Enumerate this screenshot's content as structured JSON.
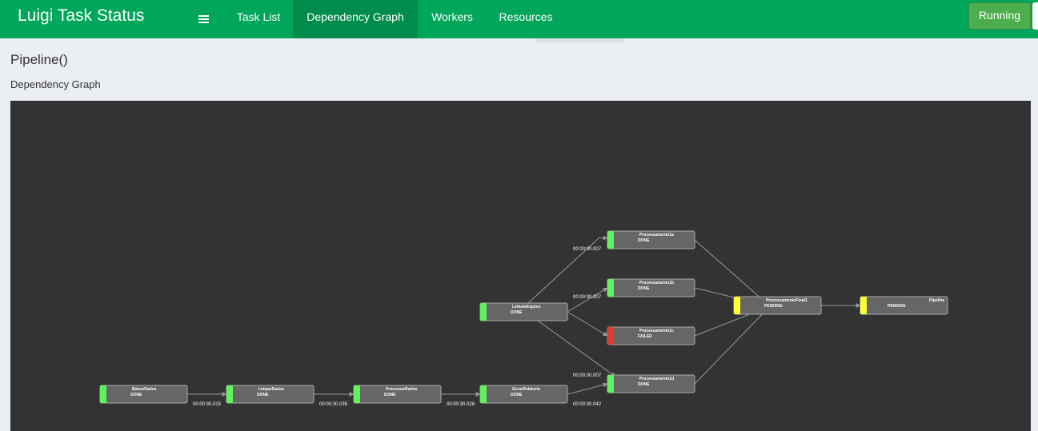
{
  "header": {
    "brand": "Luigi Task Status",
    "menu_icon": "hamburger-menu-icon",
    "tabs": [
      {
        "label": "Task List",
        "active": false
      },
      {
        "label": "Dependency Graph",
        "active": true
      },
      {
        "label": "Workers",
        "active": false
      },
      {
        "label": "Resources",
        "active": false
      }
    ],
    "status_button": "Running"
  },
  "page": {
    "title": "Pipeline()",
    "subtitle": "Dependency Graph"
  },
  "graph": {
    "status_colors": {
      "DONE": "#5ef25e",
      "FAILED": "#e23a2e",
      "PENDING": "#ffff3a"
    },
    "nodes": [
      {
        "id": "BaixarDados",
        "name": "BaixarDados",
        "status": "DONE"
      },
      {
        "id": "LimparDados",
        "name": "LimparDados",
        "status": "DONE"
      },
      {
        "id": "ProcessarDados",
        "name": "ProcessarDados",
        "status": "DONE"
      },
      {
        "id": "GerarRelatorio",
        "name": "GerarRelatorio",
        "status": "DONE"
      },
      {
        "id": "LeituraArquivo",
        "name": "LeituraArquivo",
        "status": "DONE"
      },
      {
        "id": "Processamento1a",
        "name": "Processamento1a",
        "status": "DONE"
      },
      {
        "id": "Processamento1b",
        "name": "Processamento1b",
        "status": "DONE"
      },
      {
        "id": "Processamento1c",
        "name": "Processamento1c",
        "status": "FAILED"
      },
      {
        "id": "Processamento1d",
        "name": "Processamento1d",
        "status": "DONE"
      },
      {
        "id": "ProcessamentoFinal1",
        "name": "ProcessamentoFinal1",
        "status": "PENDING"
      },
      {
        "id": "Pipeline",
        "name": "Pipeline",
        "status": "PENDING"
      }
    ],
    "edges": [
      {
        "from": "BaixarDados",
        "to": "LimparDados",
        "label": "00:00:30.015"
      },
      {
        "from": "LimparDados",
        "to": "ProcessarDados",
        "label": "00:00:30.035"
      },
      {
        "from": "ProcessarDados",
        "to": "GerarRelatorio",
        "label": "00:00:30.028"
      },
      {
        "from": "GerarRelatorio",
        "to": "Processamento1d",
        "label": "00:00:30.042"
      },
      {
        "from": "LeituraArquivo",
        "to": "Processamento1a",
        "label": "00:00:00.007"
      },
      {
        "from": "LeituraArquivo",
        "to": "Processamento1b",
        "label": "00:00:00.007"
      },
      {
        "from": "LeituraArquivo",
        "to": "Processamento1c",
        "label": ""
      },
      {
        "from": "LeituraArquivo",
        "to": "Processamento1d",
        "label": "00:00:00.007"
      },
      {
        "from": "Processamento1a",
        "to": "ProcessamentoFinal1",
        "label": ""
      },
      {
        "from": "Processamento1b",
        "to": "ProcessamentoFinal1",
        "label": ""
      },
      {
        "from": "Processamento1c",
        "to": "ProcessamentoFinal1",
        "label": ""
      },
      {
        "from": "Processamento1d",
        "to": "ProcessamentoFinal1",
        "label": ""
      },
      {
        "from": "ProcessamentoFinal1",
        "to": "Pipeline",
        "label": ""
      }
    ]
  }
}
